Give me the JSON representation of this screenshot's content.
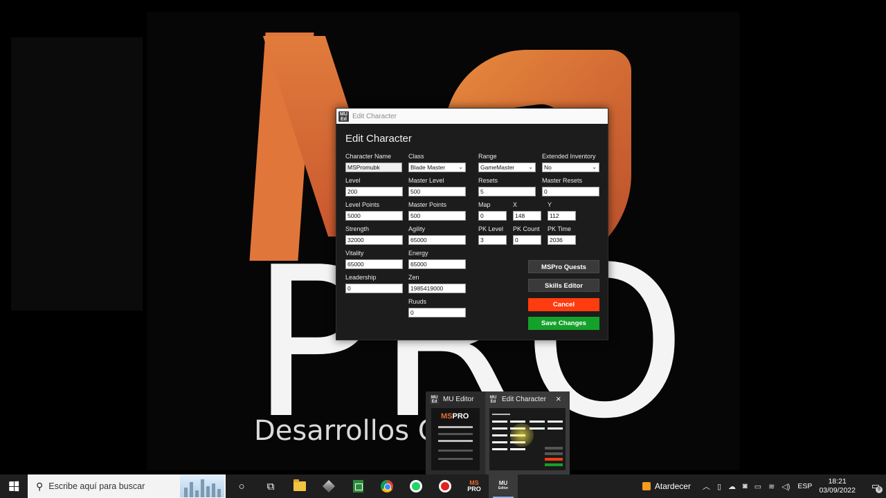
{
  "wallpaper": {
    "logo_top": "MS",
    "logo_bottom": "PRO",
    "tagline": "Desarrollos                        Online"
  },
  "dialog": {
    "window_title": "Edit Character",
    "heading": "Edit Character",
    "app_icon_text": [
      "MU",
      "Ed"
    ],
    "fields": {
      "character_name": {
        "label": "Character Name",
        "value": "MSPromubk"
      },
      "class": {
        "label": "Class",
        "value": "Blade Master"
      },
      "range": {
        "label": "Range",
        "value": "GameMaster"
      },
      "extended_inventory": {
        "label": "Extended Inventory",
        "value": "No"
      },
      "level": {
        "label": "Level",
        "value": "200"
      },
      "master_level": {
        "label": "Master Level",
        "value": "500"
      },
      "resets": {
        "label": "Resets",
        "value": "5"
      },
      "master_resets": {
        "label": "Master Resets",
        "value": "0"
      },
      "level_points": {
        "label": "Level Points",
        "value": "5000"
      },
      "master_points": {
        "label": "Master Points",
        "value": "500"
      },
      "map": {
        "label": "Map",
        "value": "0"
      },
      "x": {
        "label": "X",
        "value": "148"
      },
      "y": {
        "label": "Y",
        "value": "112"
      },
      "strength": {
        "label": "Strength",
        "value": "32000"
      },
      "agility": {
        "label": "Agility",
        "value": "65000"
      },
      "pk_level": {
        "label": "PK Level",
        "value": "3"
      },
      "pk_count": {
        "label": "PK Count",
        "value": "0"
      },
      "pk_time": {
        "label": "PK Time",
        "value": "2036"
      },
      "vitality": {
        "label": "Vitality",
        "value": "65000"
      },
      "energy": {
        "label": "Energy",
        "value": "65000"
      },
      "leadership": {
        "label": "Leadership",
        "value": "0"
      },
      "zen": {
        "label": "Zen",
        "value": "1985419000"
      },
      "ruuds": {
        "label": "Ruuds",
        "value": "0"
      }
    },
    "buttons": {
      "quests": "MSPro Quests",
      "skills": "Skills Editor",
      "cancel": "Cancel",
      "save": "Save Changes"
    },
    "colors": {
      "cancel": "#ff3c0f",
      "save": "#13a12a"
    }
  },
  "thumbnails": {
    "mu_editor": {
      "title": "MU Editor",
      "logo_a": "MS",
      "logo_b": "PRO"
    },
    "edit_character": {
      "title": "Edit Character",
      "close_icon": "×"
    }
  },
  "taskbar": {
    "search_placeholder": "Escribe aquí para buscar",
    "weather": "Atardecer",
    "language": "ESP",
    "time": "18:21",
    "date": "03/09/2022",
    "notification_count": "9",
    "mu_icon_text": "MU",
    "mu_icon_sub": "Editor",
    "mspro_icon_a": "MS",
    "mspro_icon_b": "PRO"
  }
}
